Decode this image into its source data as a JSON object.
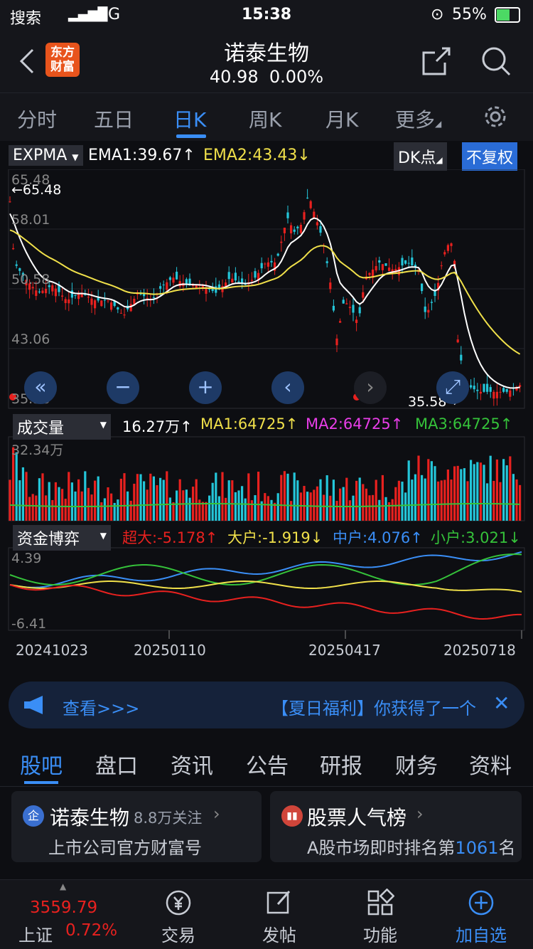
{
  "status": {
    "carrier": "搜索",
    "network": "4G",
    "time": "15:38",
    "battery": "55%"
  },
  "header": {
    "back_icon": "chevron-left-icon",
    "logo_text": "东方\n财富",
    "stock_name": "诺泰生物",
    "price": "40.98",
    "change": "0.00%",
    "share_icon": "share-icon",
    "search_icon": "search-icon"
  },
  "tabs": [
    "分时",
    "五日",
    "日K",
    "周K",
    "月K",
    "更多"
  ],
  "settings_icon": "gear-icon",
  "indicators": {
    "expma_label": "EXPMA",
    "ema1": "EMA1:39.67↑",
    "ema2": "EMA2:43.43↓",
    "dk_label": "DK点",
    "adjust_label": "不复权",
    "price_ticks": [
      "65.48",
      "58.01",
      "50.58",
      "43.06",
      "35.58"
    ],
    "high_marker": "←65.48",
    "low_marker": "35.58→",
    "vol_label": "成交量",
    "vol_value": "16.27万↑",
    "ma1": "MA1:64725↑",
    "ma2": "MA2:64725↑",
    "ma3": "MA3:64725↑",
    "vol_max": "32.34万",
    "fund_label": "资金博弈",
    "super_large": "超大:-5.178↑",
    "large": "大户:-1.919↓",
    "medium": "中户:4.076↑",
    "small": "小户:3.021↓",
    "fund_max": "4.39",
    "fund_min": "-6.41",
    "dates": [
      "20241023",
      "20250110",
      "20250417",
      "20250718"
    ]
  },
  "banner": {
    "left_text": "查看>>>",
    "right_text": "【夏日福利】你获得了一个"
  },
  "section_tabs": [
    "股吧",
    "盘口",
    "资讯",
    "公告",
    "研报",
    "财务",
    "资料"
  ],
  "card1": {
    "title": "诺泰生物",
    "followers": "8.8万关注",
    "subtitle": "上市公司官方财富号"
  },
  "card2": {
    "title": "股票人气榜",
    "subtitle_prefix": "A股市场即时排名第",
    "rank": "1061",
    "subtitle_suffix": "名"
  },
  "bottom_nav": {
    "index_value": "3559.79",
    "index_name": "上证",
    "index_change": "0.72%",
    "items": [
      "交易",
      "发帖",
      "功能",
      "加自选"
    ]
  },
  "colors": {
    "accent": "#3a8ef6",
    "up": "#e8211f",
    "down": "#24c6d9",
    "ema1": "#ffffff",
    "ema2": "#f0e04a"
  }
}
